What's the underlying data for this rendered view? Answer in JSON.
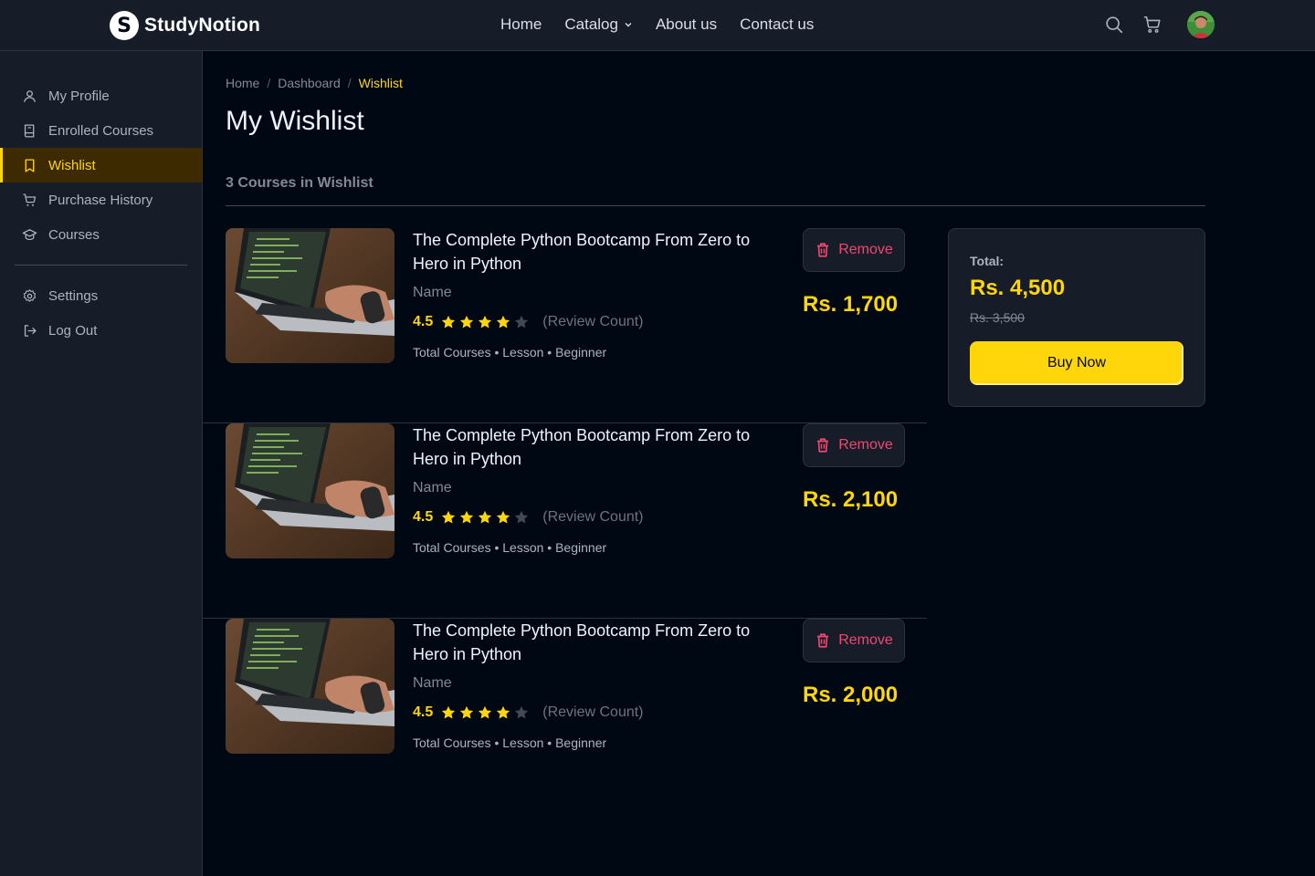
{
  "brand": {
    "name": "StudyNotion",
    "mark": "S"
  },
  "nav": {
    "links": [
      {
        "label": "Home"
      },
      {
        "label": "Catalog"
      },
      {
        "label": "About us"
      },
      {
        "label": "Contact us"
      }
    ]
  },
  "sidebar": {
    "items": [
      {
        "label": "My Profile",
        "icon": "user-icon"
      },
      {
        "label": "Enrolled Courses",
        "icon": "book-icon"
      },
      {
        "label": "Wishlist",
        "icon": "bookmark-icon",
        "active": true
      },
      {
        "label": "Purchase History",
        "icon": "cart-icon"
      },
      {
        "label": "Courses",
        "icon": "graduation-cap-icon"
      }
    ],
    "bottom_items": [
      {
        "label": "Settings",
        "icon": "gear-icon"
      },
      {
        "label": "Log Out",
        "icon": "logout-icon"
      }
    ]
  },
  "breadcrumb": {
    "items": [
      "Home",
      "Dashboard",
      "Wishlist"
    ]
  },
  "page": {
    "title": "My Wishlist",
    "count_label": "3 Courses in Wishlist"
  },
  "courses": [
    {
      "title": "The Complete Python Bootcamp From Zero to Hero in Python",
      "instructor": "Name",
      "rating": "4.5",
      "stars_filled": 4,
      "review_count": "(Review Count)",
      "meta": "Total Courses • Lesson • Beginner",
      "price": "Rs. 1,700",
      "remove_label": "Remove"
    },
    {
      "title": "The Complete Python Bootcamp From Zero to Hero in Python",
      "instructor": "Name",
      "rating": "4.5",
      "stars_filled": 4,
      "review_count": "(Review Count)",
      "meta": "Total Courses • Lesson • Beginner",
      "price": "Rs. 2,100",
      "remove_label": "Remove"
    },
    {
      "title": "The Complete Python Bootcamp From Zero to Hero in Python",
      "instructor": "Name",
      "rating": "4.5",
      "stars_filled": 4,
      "review_count": "(Review Count)",
      "meta": "Total Courses • Lesson • Beginner",
      "price": "Rs. 2,000",
      "remove_label": "Remove"
    }
  ],
  "summary": {
    "total_label": "Total:",
    "total_price": "Rs. 4,500",
    "original_price": "Rs. 3,500",
    "buy_label": "Buy Now"
  },
  "colors": {
    "accent": "#FFD60A",
    "danger": "#EF476F",
    "background": "#000814",
    "panel": "#161D29"
  }
}
